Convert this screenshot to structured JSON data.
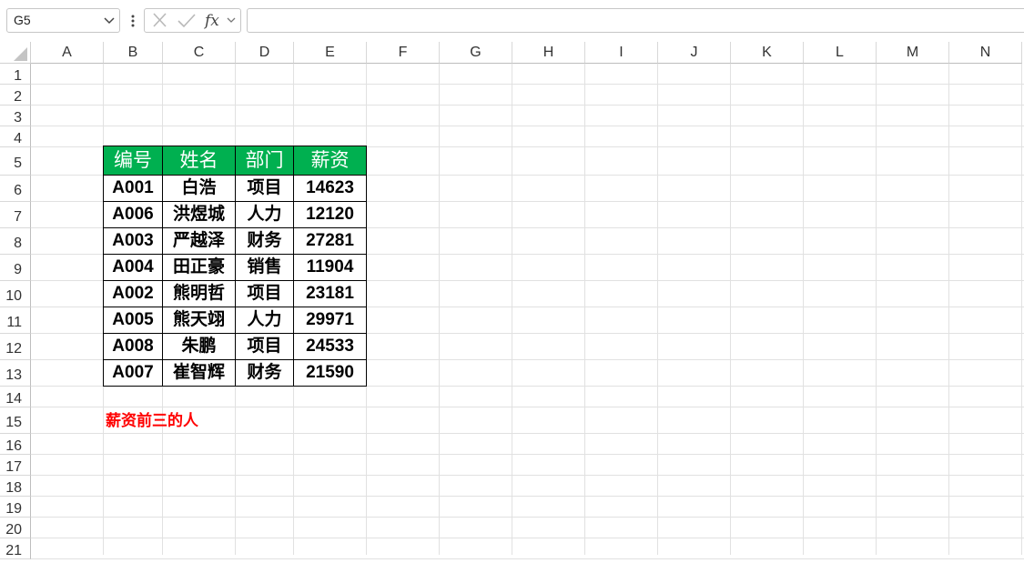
{
  "formula_bar": {
    "name_box": "G5",
    "fx_label": "fx",
    "formula": ""
  },
  "columns": [
    "A",
    "B",
    "C",
    "D",
    "E",
    "F",
    "G",
    "H",
    "I",
    "J",
    "K",
    "L",
    "M",
    "N"
  ],
  "rows": [
    "1",
    "2",
    "3",
    "4",
    "5",
    "6",
    "7",
    "8",
    "9",
    "10",
    "11",
    "12",
    "13",
    "14",
    "15",
    "16",
    "17",
    "18",
    "19",
    "20",
    "21"
  ],
  "table": {
    "headers": [
      "编号",
      "姓名",
      "部门",
      "薪资"
    ],
    "rows": [
      [
        "A001",
        "白浩",
        "项目",
        "14623"
      ],
      [
        "A006",
        "洪煜城",
        "人力",
        "12120"
      ],
      [
        "A003",
        "严越泽",
        "财务",
        "27281"
      ],
      [
        "A004",
        "田正豪",
        "销售",
        "11904"
      ],
      [
        "A002",
        "熊明哲",
        "项目",
        "23181"
      ],
      [
        "A005",
        "熊天翊",
        "人力",
        "29971"
      ],
      [
        "A008",
        "朱鹏",
        "项目",
        "24533"
      ],
      [
        "A007",
        "崔智辉",
        "财务",
        "21590"
      ]
    ],
    "header_color": "#00b050"
  },
  "note": {
    "text": "薪资前三的人",
    "color": "#ff0000"
  }
}
